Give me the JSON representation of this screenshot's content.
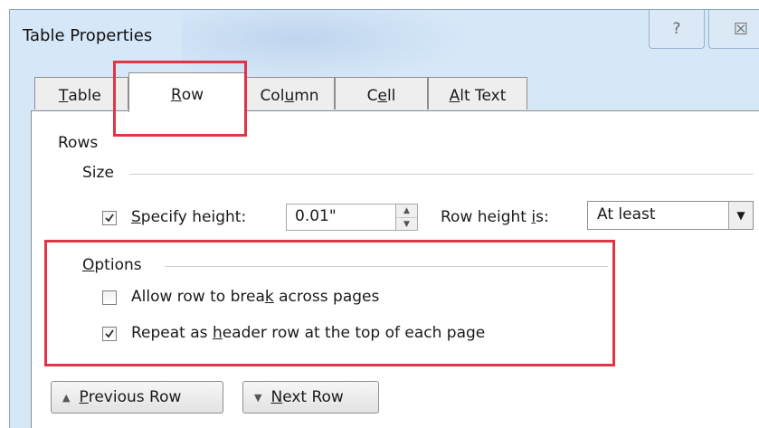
{
  "dialog": {
    "title": "Table Properties",
    "help_icon": "question-mark-icon",
    "help_glyph": "?",
    "close_icon": "close-icon",
    "close_glyph": "☒"
  },
  "tabs": [
    {
      "label": "Table",
      "underline": "T",
      "rest": "able"
    },
    {
      "label": "Row",
      "underline": "R",
      "rest": "ow"
    },
    {
      "label": "Column",
      "pre": "Col",
      "underline": "u",
      "rest": "mn"
    },
    {
      "label": "Cell",
      "pre": "C",
      "underline": "e",
      "rest": "ll"
    },
    {
      "label": "Alt Text",
      "underline": "A",
      "rest": "lt Text"
    }
  ],
  "active_tab": "Row",
  "rows": {
    "heading": "Rows",
    "size": {
      "heading": "Size",
      "specify_height": {
        "pre": "",
        "underline": "S",
        "rest": "pecify height:",
        "checked": true
      },
      "height_value": "0.01\"",
      "row_height_is": {
        "pre": "Row height ",
        "underline": "i",
        "rest": "s:"
      },
      "row_height_mode": "At least"
    },
    "options": {
      "heading_underline": "O",
      "heading_rest": "ptions",
      "allow_break": {
        "pre": "Allow row to brea",
        "underline": "k",
        "rest": " across pages",
        "checked": false
      },
      "repeat_header": {
        "pre": "Repeat as ",
        "underline": "h",
        "rest": "eader row at the top of each page",
        "checked": true
      }
    }
  },
  "buttons": {
    "previous_row": {
      "underline": "P",
      "rest": "revious Row",
      "icon": "triangle-up-icon"
    },
    "next_row": {
      "underline": "N",
      "rest": "ext Row",
      "icon": "triangle-down-icon"
    }
  },
  "colors": {
    "highlight": "#e03545",
    "dialog_bg": "#d6e7f8"
  }
}
